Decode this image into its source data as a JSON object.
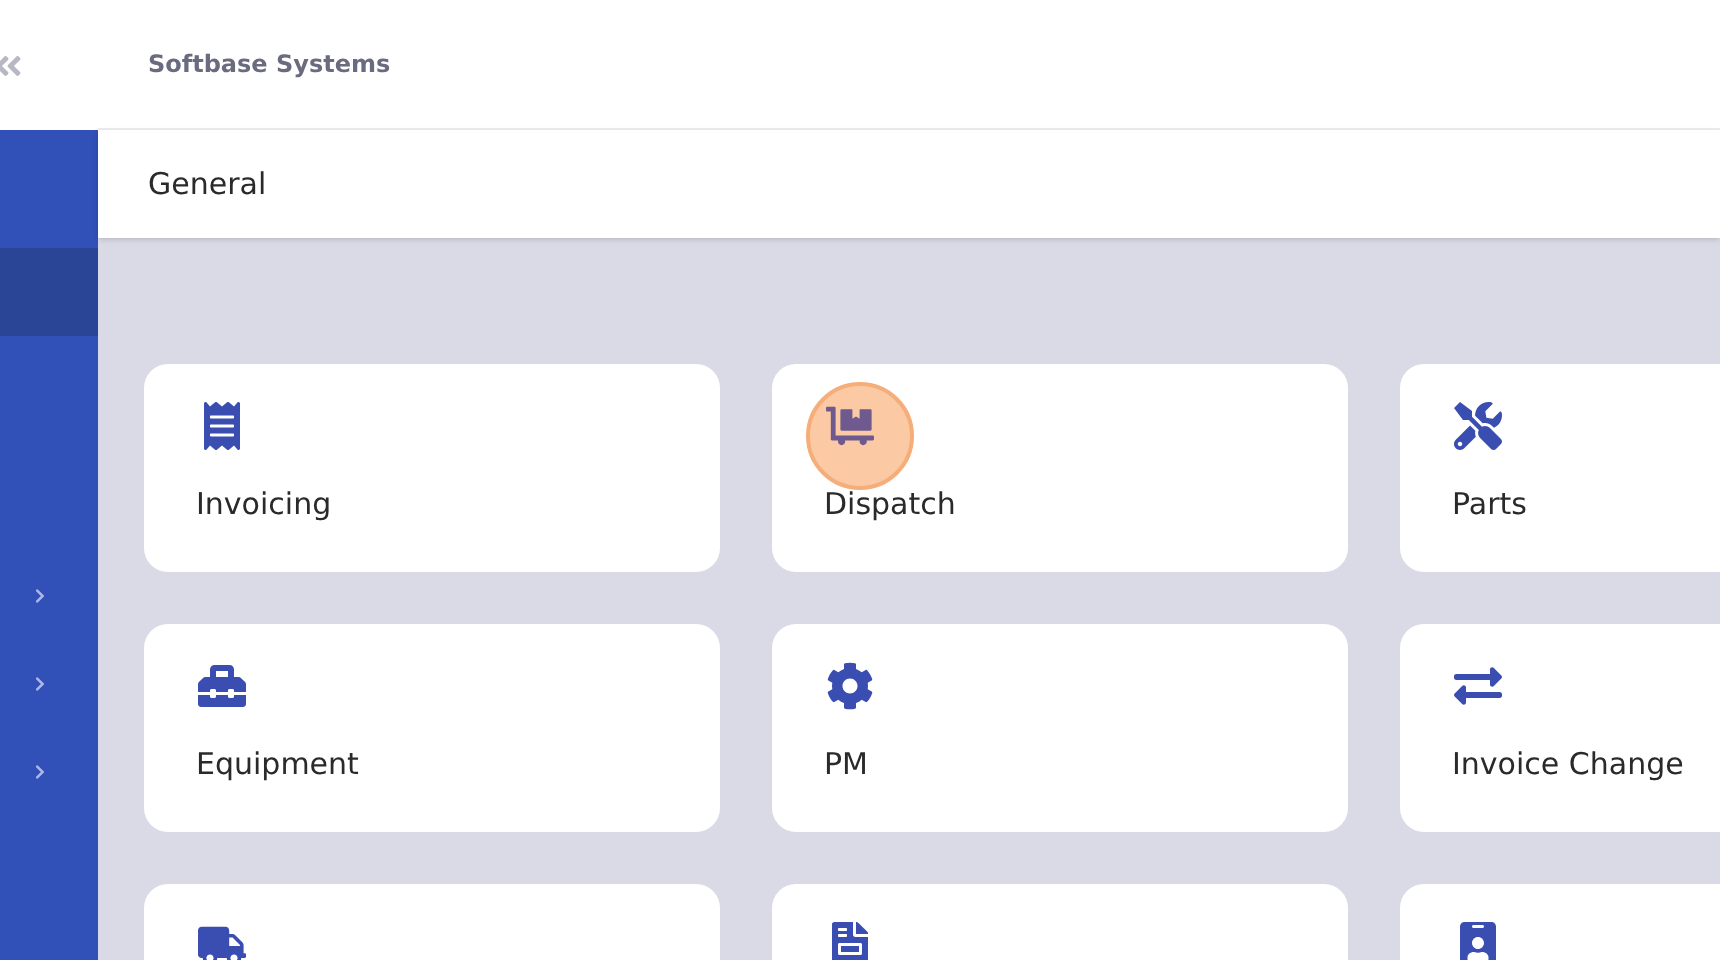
{
  "header": {
    "company": "Softbase Systems",
    "section": "General"
  },
  "sidebar": {
    "items": [
      {
        "selected": true,
        "expandable": false
      },
      {
        "selected": false,
        "expandable": true
      },
      {
        "selected": false,
        "expandable": true
      },
      {
        "selected": false,
        "expandable": true
      }
    ]
  },
  "tiles": [
    {
      "kind": "receipt",
      "label": "Invoicing",
      "highlighted": false
    },
    {
      "kind": "dolly",
      "label": "Dispatch",
      "highlighted": true
    },
    {
      "kind": "tools",
      "label": "Parts",
      "highlighted": false
    },
    {
      "kind": "toolbox",
      "label": "Equipment",
      "highlighted": false
    },
    {
      "kind": "gear",
      "label": "PM",
      "highlighted": false
    },
    {
      "kind": "exchange",
      "label": "Invoice Change",
      "highlighted": false
    },
    {
      "kind": "truck",
      "highlighted": false
    },
    {
      "kind": "file",
      "highlighted": false
    },
    {
      "kind": "badge",
      "highlighted": false
    }
  ]
}
